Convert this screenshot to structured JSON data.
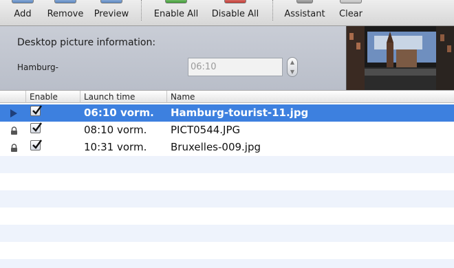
{
  "toolbar": {
    "buttons": [
      {
        "label": "Add"
      },
      {
        "label": "Remove"
      },
      {
        "label": "Preview"
      },
      {
        "label": "Enable All"
      },
      {
        "label": "Disable All"
      },
      {
        "label": "Assistant"
      },
      {
        "label": "Clear"
      }
    ]
  },
  "info": {
    "title": "Desktop picture information:",
    "name": "Hamburg-",
    "time_value": "06:10"
  },
  "table": {
    "columns": [
      "Enable",
      "Launch time",
      "Name"
    ],
    "rows": [
      {
        "status_icon": "play-arrow-icon",
        "enabled": true,
        "time": "06:10 vorm.",
        "name": "Hamburg-tourist-11.jpg",
        "selected": true
      },
      {
        "status_icon": "lock-icon",
        "enabled": true,
        "time": "08:10 vorm.",
        "name": "PICT0544.JPG",
        "selected": false
      },
      {
        "status_icon": "lock-icon",
        "enabled": true,
        "time": "10:31 vorm.",
        "name": "Bruxelles-009.jpg",
        "selected": false
      }
    ]
  },
  "colors": {
    "selection": "#3d80df",
    "stripe": "#eef3fc",
    "panel": "#c3c7d0"
  }
}
